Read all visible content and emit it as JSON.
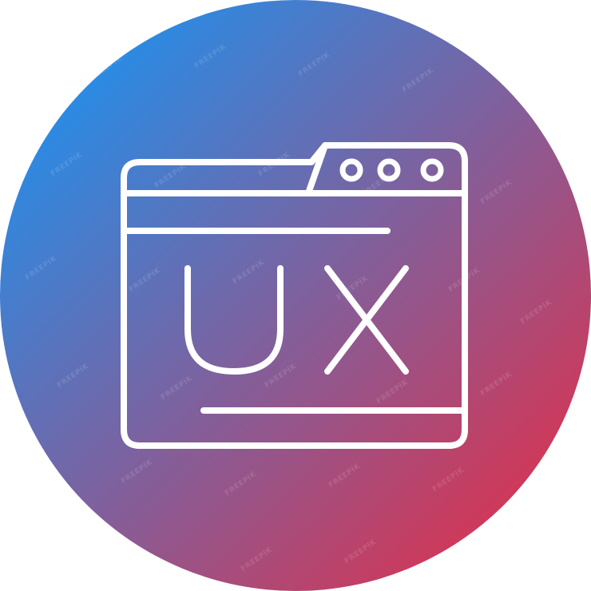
{
  "icon": {
    "name": "ux-browser-window-icon",
    "badge_text": "UX",
    "background": {
      "shape": "circle",
      "gradient_start": "#0a9bff",
      "gradient_end": "#f0283e"
    },
    "stroke_color": "#ffffff",
    "tab_dots": 3
  },
  "watermark": {
    "text": "FREEPIK"
  }
}
